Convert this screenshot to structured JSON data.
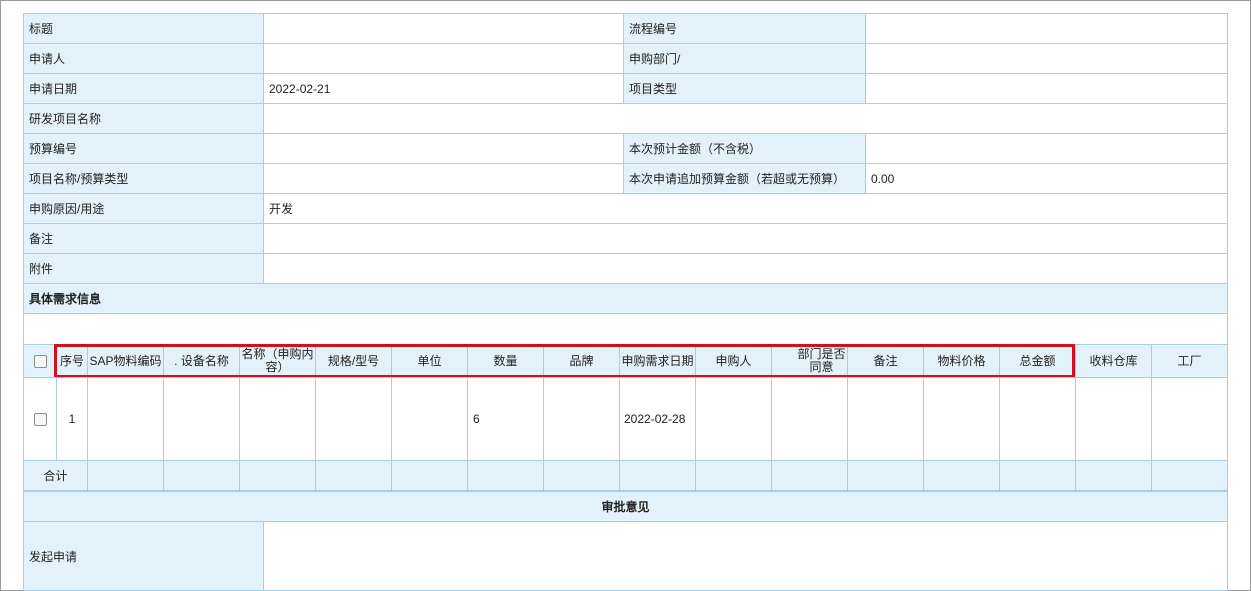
{
  "form": {
    "title_label": "标题",
    "process_no_label": "流程编号",
    "applicant_label": "申请人",
    "dept_label": "申购部门/",
    "apply_date_label": "申请日期",
    "apply_date_value": "2022-02-21",
    "project_type_label": "项目类型",
    "rd_project_label": "研发项目名称",
    "budget_no_label": "预算编号",
    "estimate_label": "本次预计金额（不含税）",
    "project_budget_label": "项目名称/预算类型",
    "extra_budget_label": "本次申请追加预算金额（若超或无预算）",
    "extra_budget_value": "0.00",
    "reason_label": "申购原因/用途",
    "reason_value": "开发",
    "remark_label": "备注",
    "attachment_label": "附件"
  },
  "detail": {
    "section_title": "具体需求信息",
    "columns": [
      "序号",
      "SAP物料编码",
      ". 设备名称",
      "名称（申购内容）",
      "规格/型号",
      "单位",
      "数量",
      "品牌",
      "申购需求日期",
      "申购人",
      "部门是否同意",
      "备注",
      "物料价格",
      "总金额",
      "收料仓库",
      "工厂"
    ],
    "row": {
      "seq": "1",
      "quantity": "6",
      "need_date": "2022-02-28"
    },
    "total_label": "合计"
  },
  "approval": {
    "section_title": "审批意见",
    "start_label": "发起申请"
  },
  "colors": {
    "label_bg": "#e3f1fb",
    "border": "#a8cde6",
    "highlight": "#d1111f"
  }
}
